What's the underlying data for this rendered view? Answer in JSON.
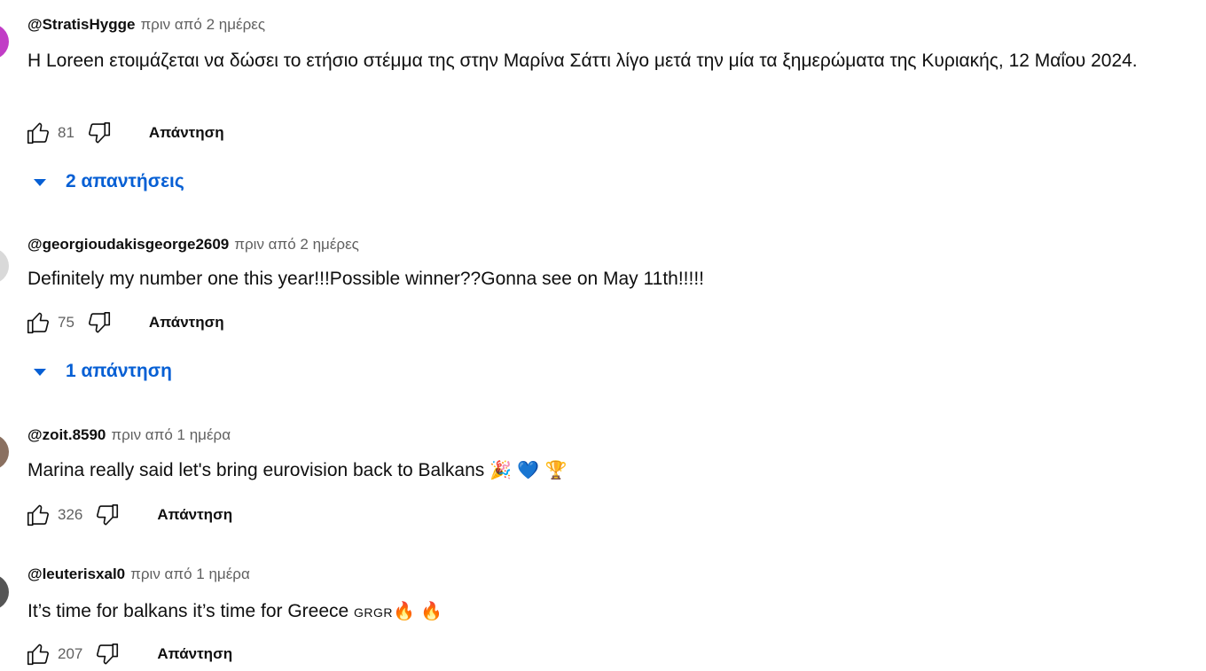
{
  "comments": [
    {
      "author": "@StratisHygge",
      "time": "πριν από 2 ημέρες",
      "text": "Η Loreen ετοιμάζεται να δώσει το ετήσιο στέμμα της στην Μαρίνα Σάττι λίγο μετά την μία τα ξημερώματα της Κυριακής, 12 Μαΐου 2024.",
      "likes": "81",
      "reply_label": "Απάντηση",
      "replies_label": "2 απαντήσεις",
      "avatar_color": "#c13dc6",
      "like_icon": "thumbs-up-icon",
      "dislike_icon": "thumbs-down-icon"
    },
    {
      "author": "@georgioudakisgeorge2609",
      "time": "πριν από 2 ημέρες",
      "text": "Definitely my number one this year!!!Possible winner??Gonna see on May 11th!!!!!",
      "likes": "75",
      "reply_label": "Απάντηση",
      "replies_label": "1 απάντηση",
      "avatar_color": "#d9d9d9"
    },
    {
      "author": "@zoit.8590",
      "time": "πριν από 1 ημέρα",
      "text": "Marina really said let's bring eurovision back to Balkans",
      "emojis": "🎉 💙 🏆",
      "likes": "326",
      "reply_label": "Απάντηση",
      "avatar_color": "#8a7060"
    },
    {
      "author": "@leuterisxal0",
      "time": "πριν από 1 ημέρα",
      "text": "It’s time for balkans it’s time for Greece",
      "flags": "GRGR",
      "emojis": "🔥 🔥",
      "likes": "207",
      "reply_label": "Απάντηση",
      "avatar_color": "#555555"
    }
  ],
  "colors": {
    "link_blue": "#065fd4",
    "secondary_text": "#606060",
    "primary_text": "#0f0f0f"
  }
}
